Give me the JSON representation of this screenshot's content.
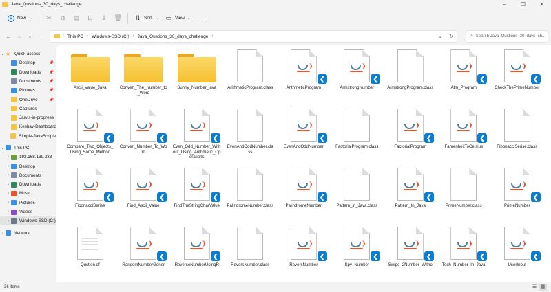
{
  "window": {
    "title": "Java_Qustions_30_days_challenge"
  },
  "toolbar": {
    "new_label": "New",
    "sort_label": "Sort",
    "view_label": "View",
    "more_label": "···"
  },
  "address": {
    "crumbs": [
      "This PC",
      "Windows-SSD (C:)",
      "Java_Qustions_30_days_challenge"
    ]
  },
  "search": {
    "placeholder": "Search Java_Qustions_30_days_ch..."
  },
  "sidebar": {
    "quick_access": {
      "label": "Quick access",
      "items": [
        {
          "label": "Desktop",
          "pinned": true,
          "color": "#3d8fe0"
        },
        {
          "label": "Downloads",
          "pinned": true,
          "color": "#2b8a5a"
        },
        {
          "label": "Documents",
          "pinned": true,
          "color": "#7a8ca3"
        },
        {
          "label": "Pictures",
          "pinned": true,
          "color": "#3d8fe0"
        },
        {
          "label": "OneDrive",
          "pinned": true,
          "color": "#f5c542"
        },
        {
          "label": "Captures",
          "pinned": false,
          "color": "#f5c542"
        },
        {
          "label": "Jarvis-in-progress",
          "pinned": false,
          "color": "#f5c542"
        },
        {
          "label": "Keshav-Dashboard",
          "pinned": false,
          "color": "#f5c542"
        },
        {
          "label": "Simple-JavaScript-C",
          "pinned": false,
          "color": "#f5c542"
        }
      ]
    },
    "this_pc": {
      "label": "This PC",
      "items": [
        {
          "label": "192.168.139.233",
          "color": "#6b9f3c"
        },
        {
          "label": "Desktop",
          "color": "#3d8fe0"
        },
        {
          "label": "Documents",
          "color": "#7a8ca3"
        },
        {
          "label": "Downloads",
          "color": "#2b8a5a"
        },
        {
          "label": "Music",
          "color": "#e4572e"
        },
        {
          "label": "Pictures",
          "color": "#3d8fe0"
        },
        {
          "label": "Videos",
          "color": "#8a4bc9"
        },
        {
          "label": "Windows-SSD (C:)",
          "color": "#6e7a86",
          "selected": true
        }
      ]
    },
    "network": {
      "label": "Network",
      "color": "#3d8fe0"
    }
  },
  "files": [
    {
      "name": "Ascii_Value_Java",
      "type": "folder"
    },
    {
      "name": "Convert_The_Number_to_Word",
      "type": "folder"
    },
    {
      "name": "Sunny_Number_java",
      "type": "folder"
    },
    {
      "name": "ArithmeticProgram.class",
      "type": "class"
    },
    {
      "name": "ArithmeticProgram",
      "type": "java"
    },
    {
      "name": "ArmstrongNumber",
      "type": "java"
    },
    {
      "name": "ArmstrongProgram.class",
      "type": "class"
    },
    {
      "name": "Atm_Program",
      "type": "java"
    },
    {
      "name": "CheckThePrimeNumber",
      "type": "java"
    },
    {
      "name": "Compare_Two_Objects_Using_Some_Method",
      "type": "java"
    },
    {
      "name": "Convert_Number_To_Word",
      "type": "java"
    },
    {
      "name": "Even_Odd_Number_Without_Using_Arithmetic_Operations",
      "type": "java"
    },
    {
      "name": "EvenAndOddNumber.class",
      "type": "class"
    },
    {
      "name": "EvenAndOddNumber",
      "type": "java"
    },
    {
      "name": "FactorialProgram.class",
      "type": "class"
    },
    {
      "name": "FactorialProgram",
      "type": "java"
    },
    {
      "name": "FahrenheitToCelsius",
      "type": "java"
    },
    {
      "name": "FibonacciSerise.class",
      "type": "class"
    },
    {
      "name": "FibonacciSerise",
      "type": "java"
    },
    {
      "name": "Find_Ascii_Value",
      "type": "java"
    },
    {
      "name": "FindTheStringCharValue",
      "type": "java"
    },
    {
      "name": "PalindromeNumber.class",
      "type": "class"
    },
    {
      "name": "PalindromeNumber",
      "type": "java"
    },
    {
      "name": "Pattern_in_Java.class",
      "type": "class"
    },
    {
      "name": "Pattern_In_Java",
      "type": "java"
    },
    {
      "name": "PrimeNumber.class",
      "type": "class"
    },
    {
      "name": "PrimeNumber",
      "type": "java"
    },
    {
      "name": "Qustion of",
      "type": "doc"
    },
    {
      "name": "RandomNumberGener",
      "type": "java"
    },
    {
      "name": "ReverseNumberUsingR",
      "type": "java"
    },
    {
      "name": "ReversNumber.class",
      "type": "class"
    },
    {
      "name": "ReversNumber",
      "type": "java"
    },
    {
      "name": "Spy_Number",
      "type": "java"
    },
    {
      "name": "Swipe_2Number_Witho",
      "type": "java"
    },
    {
      "name": "Tech_Number_In_Java",
      "type": "java"
    },
    {
      "name": "UserInput",
      "type": "java"
    }
  ],
  "status": {
    "item_count": "36 items"
  }
}
